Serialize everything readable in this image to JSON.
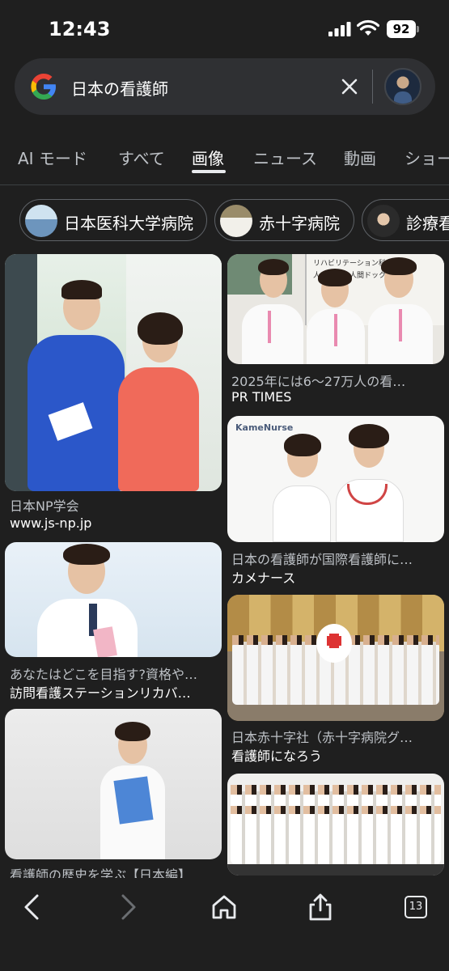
{
  "status_bar": {
    "time": "12:43",
    "battery": "92"
  },
  "search": {
    "query": "日本の看護師"
  },
  "tabs": [
    {
      "label": "AI モード"
    },
    {
      "label": "すべて"
    },
    {
      "label": "画像"
    },
    {
      "label": "ニュース"
    },
    {
      "label": "動画"
    },
    {
      "label": "ショー"
    }
  ],
  "active_tab": "画像",
  "chips": [
    {
      "label": "日本医科大学病院"
    },
    {
      "label": "赤十字病院"
    },
    {
      "label": "診療看"
    }
  ],
  "results": [
    {
      "title": "日本NP学会",
      "source": "www.js-np.jp"
    },
    {
      "title": "2025年には6～27万人の看…",
      "source": "PR TIMES"
    },
    {
      "title": "日本の看護師が国際看護師に…",
      "source": "カメナース"
    },
    {
      "title": "あなたはどこを目指す?資格や…",
      "source": "訪問看護ステーションリカバ…"
    },
    {
      "title": "日本赤十字社（赤十字病院グ…",
      "source": "看護師になろう"
    },
    {
      "title": "看護師の歴史を学ぶ【日本編】",
      "source": ""
    }
  ],
  "image_text": {
    "kamenurse_logo": "KameNurse",
    "sign_line1": "リハビリテーション科",
    "sign_line2": "人工透析・人間ドック"
  },
  "bottom_bar": {
    "tab_count": "13"
  },
  "colors": {
    "background": "#1f1f1f",
    "search_bg": "#2f3033",
    "text": "#e8eaed",
    "muted": "#bdc1c6"
  }
}
